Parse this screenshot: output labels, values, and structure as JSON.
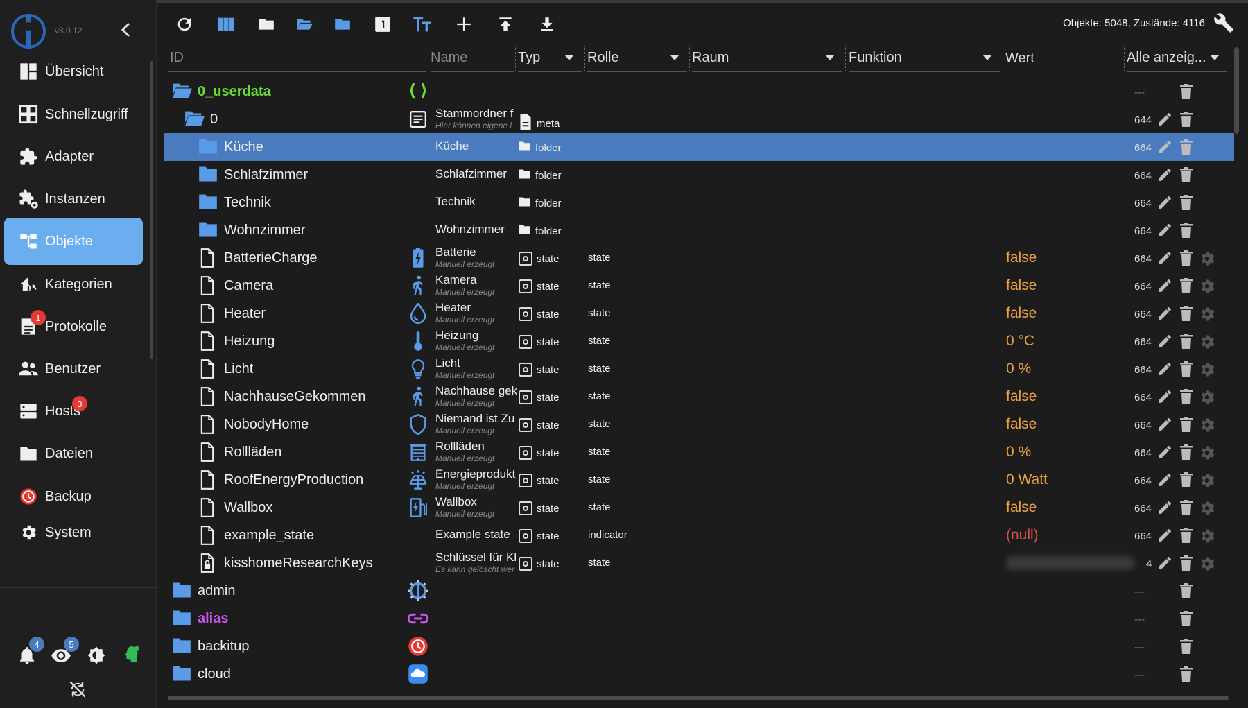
{
  "app": {
    "version": "v8.0.12"
  },
  "sidebar": {
    "items": [
      {
        "label": "Übersicht",
        "icon": "dashboard-icon"
      },
      {
        "label": "Schnellzugriff",
        "icon": "apps-icon"
      },
      {
        "label": "Adapter",
        "icon": "puzzle-icon"
      },
      {
        "label": "Instanzen",
        "icon": "puzzle-gear-icon"
      },
      {
        "label": "Objekte",
        "icon": "tree-icon",
        "active": true
      },
      {
        "label": "Kategorien",
        "icon": "home-category-icon"
      },
      {
        "label": "Protokolle",
        "icon": "log-icon",
        "badge": "1"
      },
      {
        "label": "Benutzer",
        "icon": "users-icon"
      },
      {
        "label": "Hosts",
        "icon": "server-icon",
        "badge": "3"
      },
      {
        "label": "Dateien",
        "icon": "folder-icon"
      },
      {
        "label": "Backup",
        "icon": "backup-icon"
      },
      {
        "label": "System",
        "icon": "gear-icon"
      }
    ],
    "bottom": {
      "bell_badge": "4",
      "eye_badge": "5"
    }
  },
  "toolbar": {
    "stats": "Objekte: 5048, Zustände: 4116"
  },
  "header": {
    "id": "ID",
    "name": "Name",
    "type": "Typ",
    "role": "Rolle",
    "room": "Raum",
    "function": "Funktion",
    "value": "Wert",
    "filter": "Alle anzeig..."
  },
  "rows": [
    {
      "id": "0_userdata",
      "kind": "folder-open",
      "color": "#66dd33",
      "bold": true,
      "level": 0,
      "icon": "braces-icon",
      "acl": "---",
      "actions": "d"
    },
    {
      "id": "0",
      "kind": "folder-open",
      "level": 1,
      "name": "Stammordner f",
      "sub": "Hier können eigene l",
      "icon": "list-icon",
      "type": "meta",
      "typeicon": "file",
      "acl": "644",
      "actions": "ed"
    },
    {
      "id": "Küche",
      "kind": "folder",
      "level": 2,
      "name": "Küche",
      "type": "folder",
      "typeicon": "folder",
      "acl": "664",
      "actions": "ed",
      "sel": true
    },
    {
      "id": "Schlafzimmer",
      "kind": "folder",
      "level": 2,
      "name": "Schlafzimmer",
      "type": "folder",
      "typeicon": "folder",
      "acl": "664",
      "actions": "ed"
    },
    {
      "id": "Technik",
      "kind": "folder",
      "level": 2,
      "name": "Technik",
      "type": "folder",
      "typeicon": "folder",
      "acl": "664",
      "actions": "ed"
    },
    {
      "id": "Wohnzimmer",
      "kind": "folder",
      "level": 2,
      "name": "Wohnzimmer",
      "type": "folder",
      "typeicon": "folder",
      "acl": "664",
      "actions": "ed"
    },
    {
      "id": "BatterieCharge",
      "kind": "file",
      "level": 2,
      "name": "Batterie",
      "sub": "Manuell erzeugt",
      "icon": "battery-icon",
      "type": "state",
      "typeicon": "state",
      "role": "state",
      "value": "false",
      "acl": "664",
      "actions": "eds"
    },
    {
      "id": "Camera",
      "kind": "file",
      "level": 2,
      "name": "Kamera",
      "sub": "Manuell erzeugt",
      "icon": "person-walking-icon",
      "type": "state",
      "typeicon": "state",
      "role": "state",
      "value": "false",
      "acl": "664",
      "actions": "eds"
    },
    {
      "id": "Heater",
      "kind": "file",
      "level": 2,
      "name": "Heater",
      "sub": "Manuell erzeugt",
      "icon": "drop-icon",
      "type": "state",
      "typeicon": "state",
      "role": "state",
      "value": "false",
      "acl": "664",
      "actions": "eds"
    },
    {
      "id": "Heizung",
      "kind": "file",
      "level": 2,
      "name": "Heizung",
      "sub": "Manuell erzeugt",
      "icon": "thermometer-icon",
      "type": "state",
      "typeicon": "state",
      "role": "state",
      "value": "0 °C",
      "acl": "664",
      "actions": "eds"
    },
    {
      "id": "Licht",
      "kind": "file",
      "level": 2,
      "name": "Licht",
      "sub": "Manuell erzeugt",
      "icon": "lightbulb-icon",
      "type": "state",
      "typeicon": "state",
      "role": "state",
      "value": "0 %",
      "acl": "664",
      "actions": "eds"
    },
    {
      "id": "NachhauseGekommen",
      "kind": "file",
      "level": 2,
      "name": "Nachhause gek",
      "sub": "Manuell erzeugt",
      "icon": "person-walking-icon",
      "type": "state",
      "typeicon": "state",
      "role": "state",
      "value": "false",
      "acl": "664",
      "actions": "eds"
    },
    {
      "id": "NobodyHome",
      "kind": "file",
      "level": 2,
      "name": "Niemand ist Zu",
      "sub": "Manuell erzeugt",
      "icon": "shield-icon",
      "type": "state",
      "typeicon": "state",
      "role": "state",
      "value": "false",
      "acl": "664",
      "actions": "eds"
    },
    {
      "id": "Rollläden",
      "kind": "file",
      "level": 2,
      "name": "Rollläden",
      "sub": "Manuell erzeugt",
      "icon": "blinds-icon",
      "type": "state",
      "typeicon": "state",
      "role": "state",
      "value": "0 %",
      "acl": "664",
      "actions": "eds"
    },
    {
      "id": "RoofEnergyProduction",
      "kind": "file",
      "level": 2,
      "name": "Energieprodukt",
      "sub": "Manuell erzeugt",
      "icon": "solar-panel-icon",
      "type": "state",
      "typeicon": "state",
      "role": "state",
      "value": "0 Watt",
      "acl": "664",
      "actions": "eds"
    },
    {
      "id": "Wallbox",
      "kind": "file",
      "level": 2,
      "name": "Wallbox",
      "sub": "Manuell erzeugt",
      "icon": "ev-charger-icon",
      "type": "state",
      "typeicon": "state",
      "role": "state",
      "value": "false",
      "acl": "664",
      "actions": "eds"
    },
    {
      "id": "example_state",
      "kind": "file",
      "level": 2,
      "name": "Example state",
      "type": "state",
      "typeicon": "state",
      "role": "indicator",
      "value": "(null)",
      "valnull": true,
      "acl": "664",
      "actions": "eds"
    },
    {
      "id": "kisshomeResearchKeys",
      "kind": "file-lock",
      "level": 2,
      "name": "Schlüssel für Kl",
      "sub": "Es kann gelöscht wer",
      "type": "state",
      "typeicon": "state",
      "role": "state",
      "blurred": true,
      "acl": "4",
      "actions": "eds"
    },
    {
      "id": "admin",
      "kind": "folder",
      "level": 0,
      "icon": "admin-logo-icon",
      "acl": "---",
      "actions": "d"
    },
    {
      "id": "alias",
      "kind": "folder",
      "color": "#cc55ee",
      "bold": true,
      "level": 0,
      "icon": "link-icon",
      "acl": "---",
      "actions": "d"
    },
    {
      "id": "backitup",
      "kind": "folder",
      "level": 0,
      "icon": "backitup-icon",
      "acl": "---",
      "actions": "d"
    },
    {
      "id": "cloud",
      "kind": "folder",
      "level": 0,
      "icon": "cloud-icon",
      "acl": "---",
      "actions": "d"
    }
  ]
}
